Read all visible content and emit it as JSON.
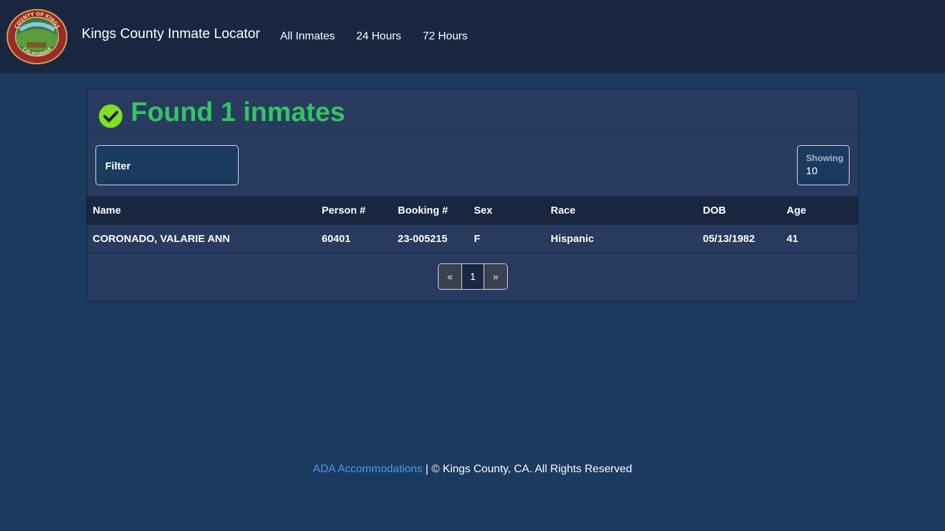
{
  "header": {
    "brand": "Kings County Inmate Locator",
    "nav": [
      {
        "label": "All Inmates"
      },
      {
        "label": "24 Hours"
      },
      {
        "label": "72 Hours"
      }
    ],
    "logo_text": {
      "top": "COUNTY OF KINGS",
      "bottom": "CALIFORNIA"
    }
  },
  "results": {
    "title": "Found 1 inmates",
    "filter_label": "Filter",
    "showing_label": "Showing",
    "showing_value": "10"
  },
  "table": {
    "columns": [
      "Name",
      "Person #",
      "Booking #",
      "Sex",
      "Race",
      "DOB",
      "Age"
    ],
    "rows": [
      [
        "CORONADO, VALARIE ANN",
        "60401",
        "23-005215",
        "F",
        "Hispanic",
        "05/13/1982",
        "41"
      ]
    ]
  },
  "pagination": {
    "prev": "«",
    "current": "1",
    "next": "»"
  },
  "footer": {
    "link": "ADA Accommodations",
    "separator": "|",
    "text": "© Kings County, CA. All Rights Reserved"
  },
  "colors": {
    "page_bg": "#1b3a60",
    "navbar_bg": "#182640",
    "card_bg": "#283a5e",
    "success_green": "#33c463",
    "link_blue": "#4f96f2"
  }
}
